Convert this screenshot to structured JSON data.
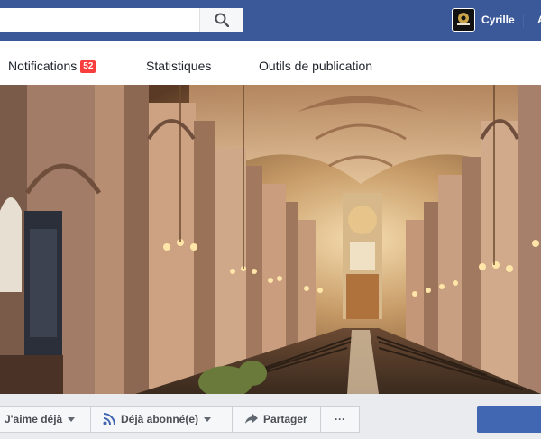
{
  "header": {
    "search": {
      "placeholder": "",
      "value": ""
    },
    "user": {
      "name": "Cyrille"
    },
    "next_link_initial": "A"
  },
  "tabs": [
    {
      "label": "Notifications",
      "badge": "52"
    },
    {
      "label": "Statistiques"
    },
    {
      "label": "Outils de publication"
    }
  ],
  "cover": {
    "description_icon": "cathedral-nave-photo"
  },
  "actions": {
    "like_label": "J'aime déjà",
    "follow_label": "Déjà abonné(e)",
    "share_label": "Partager",
    "more_label": "···"
  },
  "colors": {
    "brand_blue": "#3b5998",
    "badge_red": "#fa3e3e",
    "button_bg": "#f6f7f9",
    "primary_button": "#4267b2"
  }
}
